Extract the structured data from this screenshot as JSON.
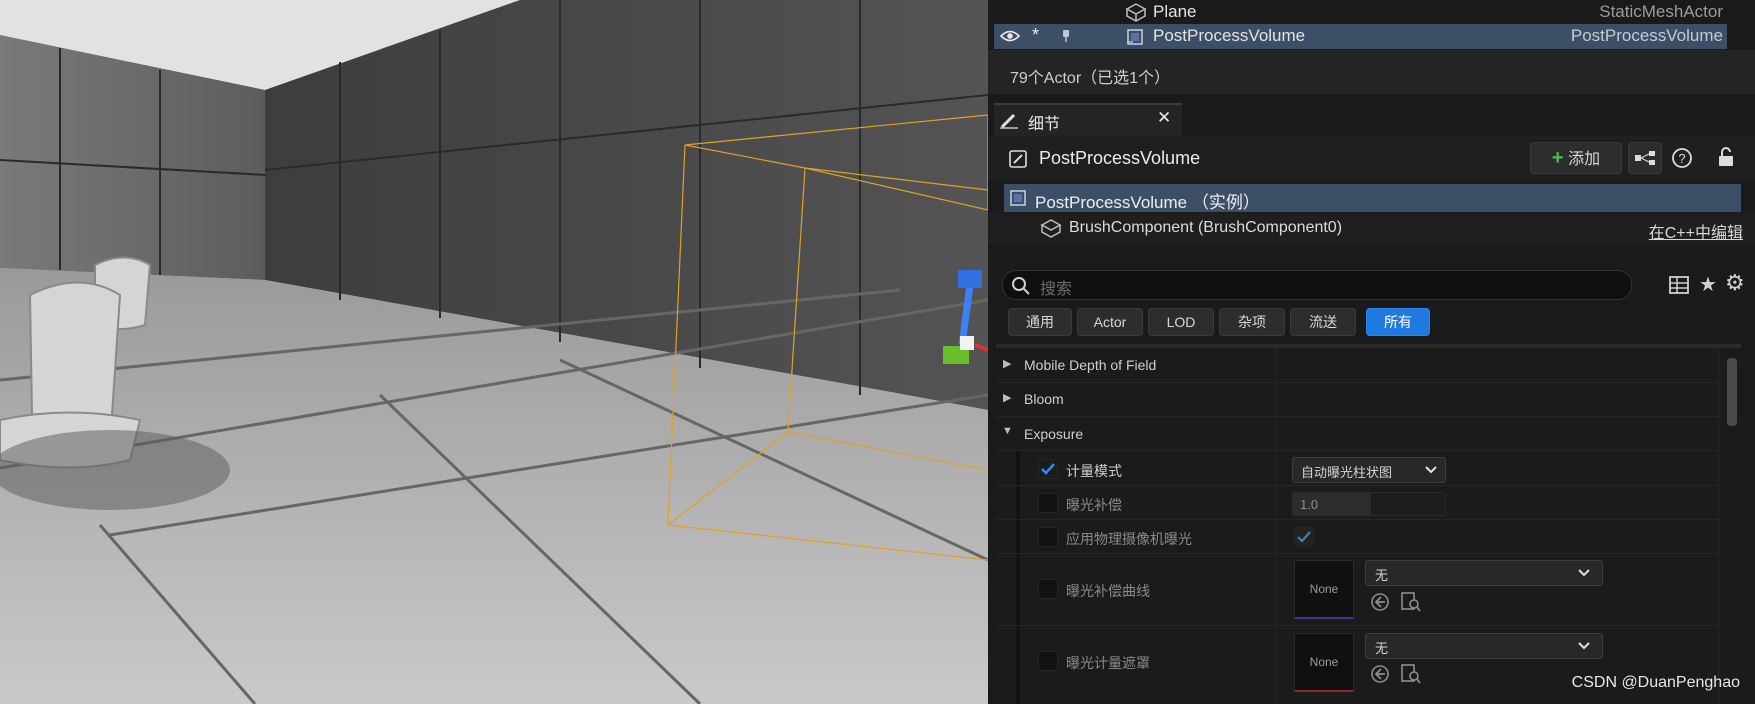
{
  "outliner": {
    "rows": [
      {
        "name": "Plane",
        "type": "StaticMeshActor",
        "selected": false
      },
      {
        "name": "PostProcessVolume",
        "type": "PostProcessVolume",
        "selected": true
      }
    ],
    "status": "79个Actor（已选1个）"
  },
  "details": {
    "tab_label": "细节",
    "actor_name": "PostProcessVolume",
    "add_label": "添加",
    "components": [
      {
        "name": "PostProcessVolume （实例）",
        "selected": true
      },
      {
        "name": "BrushComponent (BrushComponent0)",
        "link": "在C++中编辑"
      }
    ],
    "search_placeholder": "搜索",
    "filters": [
      "通用",
      "Actor",
      "LOD",
      "杂项",
      "流送",
      "所有"
    ],
    "active_filter": "所有",
    "sections": {
      "mobile_dof": "Mobile Depth of Field",
      "bloom": "Bloom",
      "exposure": "Exposure"
    },
    "exposure": {
      "metering_mode_label": "计量模式",
      "metering_mode_value": "自动曝光柱状图",
      "compensation_label": "曝光补偿",
      "compensation_value": "1.0",
      "physical_camera_label": "应用物理摄像机曝光",
      "curve_label": "曝光补偿曲线",
      "curve_value": "无",
      "curve_thumb": "None",
      "mask_label": "曝光计量遮罩",
      "mask_value": "无",
      "mask_thumb": "None"
    }
  },
  "watermark": "CSDN @DuanPenghao",
  "colors": {
    "accent": "#1f7ae0",
    "selection": "#3c4f66",
    "volume_outline": "#e0a125"
  }
}
